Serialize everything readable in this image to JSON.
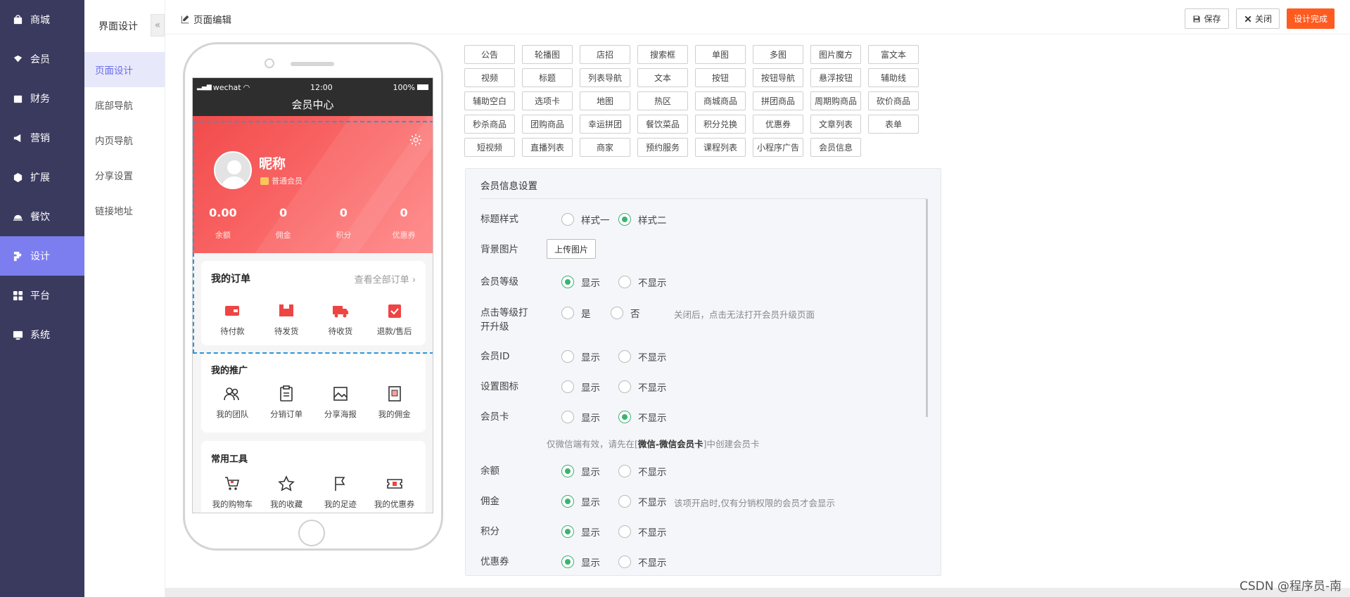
{
  "sidebar": {
    "items": [
      {
        "label": "商城",
        "icon": "shop-icon",
        "active": false
      },
      {
        "label": "会员",
        "icon": "member-icon",
        "active": false
      },
      {
        "label": "财务",
        "icon": "finance-icon",
        "active": false
      },
      {
        "label": "营销",
        "icon": "marketing-icon",
        "active": false
      },
      {
        "label": "扩展",
        "icon": "extension-icon",
        "active": false
      },
      {
        "label": "餐饮",
        "icon": "catering-icon",
        "active": false
      },
      {
        "label": "设计",
        "icon": "design-icon",
        "active": true
      },
      {
        "label": "平台",
        "icon": "platform-icon",
        "active": false
      },
      {
        "label": "系统",
        "icon": "system-icon",
        "active": false
      }
    ]
  },
  "subnav": {
    "title": "界面设计",
    "collapse": "«",
    "items": [
      {
        "label": "页面设计",
        "active": true
      },
      {
        "label": "底部导航",
        "active": false
      },
      {
        "label": "内页导航",
        "active": false
      },
      {
        "label": "分享设置",
        "active": false
      },
      {
        "label": "链接地址",
        "active": false
      }
    ]
  },
  "topbar": {
    "title": "页面编辑",
    "save": "保存",
    "close": "关闭",
    "done": "设计完成"
  },
  "phone": {
    "status": {
      "carrier": "wechat",
      "time": "12:00",
      "battery": "100%"
    },
    "nav_title": "会员中心",
    "nickname": "昵称",
    "level": "普通会员",
    "stats": [
      {
        "value": "0.00",
        "label": "余额"
      },
      {
        "value": "0",
        "label": "佣金"
      },
      {
        "value": "0",
        "label": "积分"
      },
      {
        "value": "0",
        "label": "优惠券"
      }
    ],
    "orders": {
      "title": "我的订单",
      "more": "查看全部订单",
      "items": [
        {
          "label": "待付款",
          "icon": "wallet-icon"
        },
        {
          "label": "待发货",
          "icon": "box-icon"
        },
        {
          "label": "待收货",
          "icon": "truck-icon"
        },
        {
          "label": "退款/售后",
          "icon": "refund-icon"
        }
      ]
    },
    "promo": {
      "title": "我的推广",
      "items": [
        {
          "label": "我的团队",
          "icon": "team-icon"
        },
        {
          "label": "分销订单",
          "icon": "clipboard-icon"
        },
        {
          "label": "分享海报",
          "icon": "poster-icon"
        },
        {
          "label": "我的佣金",
          "icon": "commission-icon"
        }
      ]
    },
    "tools": {
      "title": "常用工具",
      "items": [
        {
          "label": "我的购物车",
          "icon": "cart-icon"
        },
        {
          "label": "我的收藏",
          "icon": "star-icon"
        },
        {
          "label": "我的足迹",
          "icon": "flag-icon"
        },
        {
          "label": "我的优惠券",
          "icon": "coupon-icon"
        }
      ]
    }
  },
  "palette": [
    [
      "公告",
      "轮播图",
      "店招",
      "搜索框",
      "单图",
      "多图",
      "图片魔方",
      "富文本"
    ],
    [
      "视频",
      "标题",
      "列表导航",
      "文本",
      "按钮",
      "按钮导航",
      "悬浮按钮",
      "辅助线"
    ],
    [
      "辅助空白",
      "选项卡",
      "地图",
      "热区",
      "商城商品",
      "拼团商品",
      "周期购商品",
      "砍价商品"
    ],
    [
      "秒杀商品",
      "团购商品",
      "幸运拼团",
      "餐饮菜品",
      "积分兑换",
      "优惠券",
      "文章列表",
      "表单"
    ],
    [
      "短视频",
      "直播列表",
      "商家",
      "预约服务",
      "课程列表",
      "小程序广告",
      "会员信息"
    ]
  ],
  "panel": {
    "title": "会员信息设置",
    "title_style": {
      "label": "标题样式",
      "opt1": "样式一",
      "opt2": "样式二",
      "selected": 2
    },
    "bg": {
      "label": "背景图片",
      "button": "上传图片"
    },
    "rows": [
      {
        "label": "会员等级",
        "opt1": "显示",
        "opt2": "不显示",
        "selected": 1,
        "note": ""
      },
      {
        "label": "点击等级打开升级",
        "opt1": "是",
        "opt2": "否",
        "selected": 0,
        "note": "关闭后，点击无法打开会员升级页面"
      },
      {
        "label": "会员ID",
        "opt1": "显示",
        "opt2": "不显示",
        "selected": 0,
        "note": ""
      },
      {
        "label": "设置图标",
        "opt1": "显示",
        "opt2": "不显示",
        "selected": 0,
        "note": ""
      },
      {
        "label": "会员卡",
        "opt1": "显示",
        "opt2": "不显示",
        "selected": 2,
        "note": ""
      },
      {
        "label": "余额",
        "opt1": "显示",
        "opt2": "不显示",
        "selected": 1,
        "note": ""
      },
      {
        "label": "佣金",
        "opt1": "显示",
        "opt2": "不显示",
        "selected": 1,
        "note": "该项开启时,仅有分销权限的会员才会显示"
      },
      {
        "label": "积分",
        "opt1": "显示",
        "opt2": "不显示",
        "selected": 1,
        "note": ""
      },
      {
        "label": "优惠券",
        "opt1": "显示",
        "opt2": "不显示",
        "selected": 1,
        "note": ""
      }
    ],
    "card_note_pre": "仅微信端有效，请先在[",
    "card_note_bold": "微信-微信会员卡",
    "card_note_post": "]中创建会员卡"
  },
  "watermark": "CSDN @程序员-南",
  "colors": {
    "sidebar": "#3a3a5f",
    "active": "#7c7ef0",
    "accent": "#ff5a1f",
    "hero": "#f24b4b",
    "radio": "#3cb371"
  }
}
